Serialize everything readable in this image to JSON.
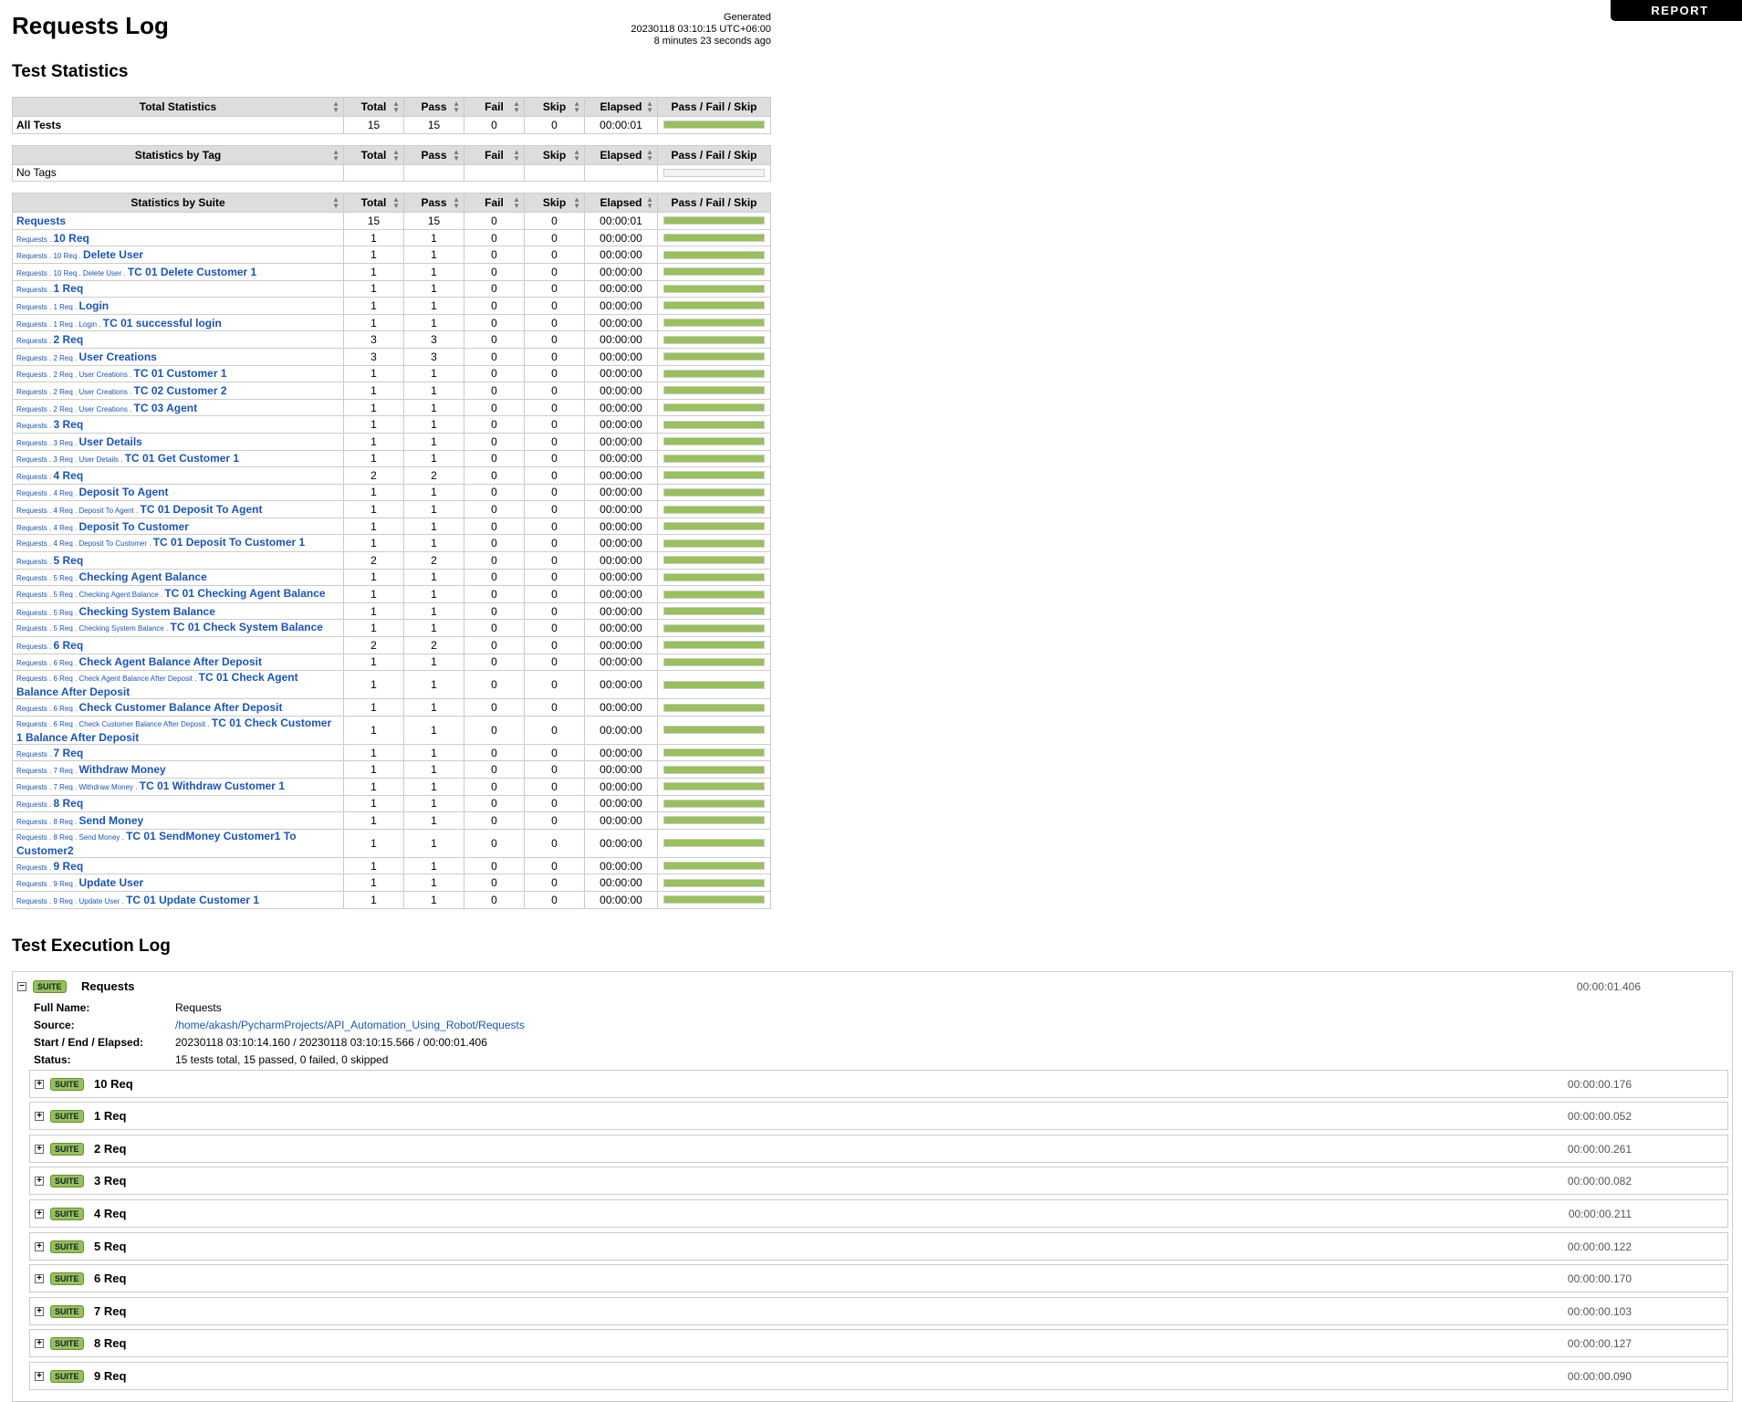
{
  "header": {
    "title": "Requests Log",
    "generated_label": "Generated",
    "generated_time": "20230118 03:10:15 UTC+06:00",
    "generated_ago": "8 minutes 23 seconds ago",
    "report_button": "REPORT"
  },
  "sections": {
    "test_statistics": "Test Statistics",
    "execution_log": "Test Execution Log"
  },
  "columns": [
    "Total",
    "Pass",
    "Fail",
    "Skip",
    "Elapsed",
    "Pass / Fail / Skip"
  ],
  "total_stats": {
    "header": "Total Statistics",
    "rows": [
      {
        "name": "All Tests",
        "total": "15",
        "pass": "15",
        "fail": "0",
        "skip": "0",
        "elapsed": "00:00:01",
        "pass_fraction": 1
      }
    ]
  },
  "tag_stats": {
    "header": "Statistics by Tag",
    "rows": [
      {
        "name": "No Tags",
        "total": "",
        "pass": "",
        "fail": "",
        "skip": "",
        "elapsed": "",
        "pass_fraction": 0
      }
    ]
  },
  "suite_stats": {
    "header": "Statistics by Suite",
    "rows": [
      {
        "parent": "",
        "name": "Requests",
        "total": "15",
        "pass": "15",
        "fail": "0",
        "skip": "0",
        "elapsed": "00:00:01",
        "pass_fraction": 1
      },
      {
        "parent": "Requests . ",
        "name": "10 Req",
        "total": "1",
        "pass": "1",
        "fail": "0",
        "skip": "0",
        "elapsed": "00:00:00",
        "pass_fraction": 1
      },
      {
        "parent": "Requests . 10 Req . ",
        "name": "Delete User",
        "total": "1",
        "pass": "1",
        "fail": "0",
        "skip": "0",
        "elapsed": "00:00:00",
        "pass_fraction": 1
      },
      {
        "parent": "Requests . 10 Req . Delete User . ",
        "name": "TC 01 Delete Customer 1",
        "total": "1",
        "pass": "1",
        "fail": "0",
        "skip": "0",
        "elapsed": "00:00:00",
        "pass_fraction": 1
      },
      {
        "parent": "Requests . ",
        "name": "1 Req",
        "total": "1",
        "pass": "1",
        "fail": "0",
        "skip": "0",
        "elapsed": "00:00:00",
        "pass_fraction": 1
      },
      {
        "parent": "Requests . 1 Req . ",
        "name": "Login",
        "total": "1",
        "pass": "1",
        "fail": "0",
        "skip": "0",
        "elapsed": "00:00:00",
        "pass_fraction": 1
      },
      {
        "parent": "Requests . 1 Req . Login . ",
        "name": "TC 01 successful login",
        "total": "1",
        "pass": "1",
        "fail": "0",
        "skip": "0",
        "elapsed": "00:00:00",
        "pass_fraction": 1
      },
      {
        "parent": "Requests . ",
        "name": "2 Req",
        "total": "3",
        "pass": "3",
        "fail": "0",
        "skip": "0",
        "elapsed": "00:00:00",
        "pass_fraction": 1
      },
      {
        "parent": "Requests . 2 Req . ",
        "name": "User Creations",
        "total": "3",
        "pass": "3",
        "fail": "0",
        "skip": "0",
        "elapsed": "00:00:00",
        "pass_fraction": 1
      },
      {
        "parent": "Requests . 2 Req . User Creations . ",
        "name": "TC 01 Customer 1",
        "total": "1",
        "pass": "1",
        "fail": "0",
        "skip": "0",
        "elapsed": "00:00:00",
        "pass_fraction": 1
      },
      {
        "parent": "Requests . 2 Req . User Creations . ",
        "name": "TC 02 Customer 2",
        "total": "1",
        "pass": "1",
        "fail": "0",
        "skip": "0",
        "elapsed": "00:00:00",
        "pass_fraction": 1
      },
      {
        "parent": "Requests . 2 Req . User Creations . ",
        "name": "TC 03 Agent",
        "total": "1",
        "pass": "1",
        "fail": "0",
        "skip": "0",
        "elapsed": "00:00:00",
        "pass_fraction": 1
      },
      {
        "parent": "Requests . ",
        "name": "3 Req",
        "total": "1",
        "pass": "1",
        "fail": "0",
        "skip": "0",
        "elapsed": "00:00:00",
        "pass_fraction": 1
      },
      {
        "parent": "Requests . 3 Req . ",
        "name": "User Details",
        "total": "1",
        "pass": "1",
        "fail": "0",
        "skip": "0",
        "elapsed": "00:00:00",
        "pass_fraction": 1
      },
      {
        "parent": "Requests . 3 Req . User Details . ",
        "name": "TC 01 Get Customer 1",
        "total": "1",
        "pass": "1",
        "fail": "0",
        "skip": "0",
        "elapsed": "00:00:00",
        "pass_fraction": 1
      },
      {
        "parent": "Requests . ",
        "name": "4 Req",
        "total": "2",
        "pass": "2",
        "fail": "0",
        "skip": "0",
        "elapsed": "00:00:00",
        "pass_fraction": 1
      },
      {
        "parent": "Requests . 4 Req . ",
        "name": "Deposit To Agent",
        "total": "1",
        "pass": "1",
        "fail": "0",
        "skip": "0",
        "elapsed": "00:00:00",
        "pass_fraction": 1
      },
      {
        "parent": "Requests . 4 Req . Deposit To Agent . ",
        "name": "TC 01 Deposit To Agent",
        "total": "1",
        "pass": "1",
        "fail": "0",
        "skip": "0",
        "elapsed": "00:00:00",
        "pass_fraction": 1
      },
      {
        "parent": "Requests . 4 Req . ",
        "name": "Deposit To Customer",
        "total": "1",
        "pass": "1",
        "fail": "0",
        "skip": "0",
        "elapsed": "00:00:00",
        "pass_fraction": 1
      },
      {
        "parent": "Requests . 4 Req . Deposit To Customer . ",
        "name": "TC 01 Deposit To Customer 1",
        "total": "1",
        "pass": "1",
        "fail": "0",
        "skip": "0",
        "elapsed": "00:00:00",
        "pass_fraction": 1
      },
      {
        "parent": "Requests . ",
        "name": "5 Req",
        "total": "2",
        "pass": "2",
        "fail": "0",
        "skip": "0",
        "elapsed": "00:00:00",
        "pass_fraction": 1
      },
      {
        "parent": "Requests . 5 Req . ",
        "name": "Checking Agent Balance",
        "total": "1",
        "pass": "1",
        "fail": "0",
        "skip": "0",
        "elapsed": "00:00:00",
        "pass_fraction": 1
      },
      {
        "parent": "Requests . 5 Req . Checking Agent Balance . ",
        "name": "TC 01 Checking Agent Balance",
        "total": "1",
        "pass": "1",
        "fail": "0",
        "skip": "0",
        "elapsed": "00:00:00",
        "pass_fraction": 1
      },
      {
        "parent": "Requests . 5 Req . ",
        "name": "Checking System Balance",
        "total": "1",
        "pass": "1",
        "fail": "0",
        "skip": "0",
        "elapsed": "00:00:00",
        "pass_fraction": 1
      },
      {
        "parent": "Requests . 5 Req . Checking System Balance . ",
        "name": "TC 01 Check System Balance",
        "total": "1",
        "pass": "1",
        "fail": "0",
        "skip": "0",
        "elapsed": "00:00:00",
        "pass_fraction": 1
      },
      {
        "parent": "Requests . ",
        "name": "6 Req",
        "total": "2",
        "pass": "2",
        "fail": "0",
        "skip": "0",
        "elapsed": "00:00:00",
        "pass_fraction": 1
      },
      {
        "parent": "Requests . 6 Req . ",
        "name": "Check Agent Balance After Deposit",
        "total": "1",
        "pass": "1",
        "fail": "0",
        "skip": "0",
        "elapsed": "00:00:00",
        "pass_fraction": 1
      },
      {
        "parent": "Requests . 6 Req . Check Agent Balance After Deposit . ",
        "name": "TC 01 Check Agent Balance After Deposit",
        "total": "1",
        "pass": "1",
        "fail": "0",
        "skip": "0",
        "elapsed": "00:00:00",
        "pass_fraction": 1
      },
      {
        "parent": "Requests . 6 Req . ",
        "name": "Check Customer Balance After Deposit",
        "total": "1",
        "pass": "1",
        "fail": "0",
        "skip": "0",
        "elapsed": "00:00:00",
        "pass_fraction": 1
      },
      {
        "parent": "Requests . 6 Req . Check Customer Balance After Deposit . ",
        "name": "TC 01 Check Customer 1 Balance After Deposit",
        "total": "1",
        "pass": "1",
        "fail": "0",
        "skip": "0",
        "elapsed": "00:00:00",
        "pass_fraction": 1
      },
      {
        "parent": "Requests . ",
        "name": "7 Req",
        "total": "1",
        "pass": "1",
        "fail": "0",
        "skip": "0",
        "elapsed": "00:00:00",
        "pass_fraction": 1
      },
      {
        "parent": "Requests . 7 Req . ",
        "name": "Withdraw Money",
        "total": "1",
        "pass": "1",
        "fail": "0",
        "skip": "0",
        "elapsed": "00:00:00",
        "pass_fraction": 1
      },
      {
        "parent": "Requests . 7 Req . Withdraw Money . ",
        "name": "TC 01 Withdraw Customer 1",
        "total": "1",
        "pass": "1",
        "fail": "0",
        "skip": "0",
        "elapsed": "00:00:00",
        "pass_fraction": 1
      },
      {
        "parent": "Requests . ",
        "name": "8 Req",
        "total": "1",
        "pass": "1",
        "fail": "0",
        "skip": "0",
        "elapsed": "00:00:00",
        "pass_fraction": 1
      },
      {
        "parent": "Requests . 8 Req . ",
        "name": "Send Money",
        "total": "1",
        "pass": "1",
        "fail": "0",
        "skip": "0",
        "elapsed": "00:00:00",
        "pass_fraction": 1
      },
      {
        "parent": "Requests . 8 Req . Send Money . ",
        "name": "TC 01 SendMoney Customer1 To Customer2",
        "total": "1",
        "pass": "1",
        "fail": "0",
        "skip": "0",
        "elapsed": "00:00:00",
        "pass_fraction": 1
      },
      {
        "parent": "Requests . ",
        "name": "9 Req",
        "total": "1",
        "pass": "1",
        "fail": "0",
        "skip": "0",
        "elapsed": "00:00:00",
        "pass_fraction": 1
      },
      {
        "parent": "Requests . 9 Req . ",
        "name": "Update User",
        "total": "1",
        "pass": "1",
        "fail": "0",
        "skip": "0",
        "elapsed": "00:00:00",
        "pass_fraction": 1
      },
      {
        "parent": "Requests . 9 Req . Update User . ",
        "name": "TC 01 Update Customer 1",
        "total": "1",
        "pass": "1",
        "fail": "0",
        "skip": "0",
        "elapsed": "00:00:00",
        "pass_fraction": 1
      }
    ]
  },
  "log": {
    "root": {
      "label": "SUITE",
      "name": "Requests",
      "elapsed": "00:00:01.406",
      "toggle": "−",
      "meta": [
        {
          "key": "Full Name:",
          "value": "Requests"
        },
        {
          "key": "Source:",
          "value": "/home/akash/PycharmProjects/API_Automation_Using_Robot/Requests"
        },
        {
          "key": "Start / End / Elapsed:",
          "value": "20230118 03:10:14.160 / 20230118 03:10:15.566 / 00:00:01.406"
        },
        {
          "key": "Status:",
          "value": "15 tests total, 15 passed, 0 failed, 0 skipped"
        }
      ]
    },
    "children": [
      {
        "label": "SUITE",
        "name": "10 Req",
        "elapsed": "00:00:00.176",
        "toggle": "+"
      },
      {
        "label": "SUITE",
        "name": "1 Req",
        "elapsed": "00:00:00.052",
        "toggle": "+"
      },
      {
        "label": "SUITE",
        "name": "2 Req",
        "elapsed": "00:00:00.261",
        "toggle": "+"
      },
      {
        "label": "SUITE",
        "name": "3 Req",
        "elapsed": "00:00:00.082",
        "toggle": "+"
      },
      {
        "label": "SUITE",
        "name": "4 Req",
        "elapsed": "00:00:00.211",
        "toggle": "+"
      },
      {
        "label": "SUITE",
        "name": "5 Req",
        "elapsed": "00:00:00.122",
        "toggle": "+"
      },
      {
        "label": "SUITE",
        "name": "6 Req",
        "elapsed": "00:00:00.170",
        "toggle": "+"
      },
      {
        "label": "SUITE",
        "name": "7 Req",
        "elapsed": "00:00:00.103",
        "toggle": "+"
      },
      {
        "label": "SUITE",
        "name": "8 Req",
        "elapsed": "00:00:00.127",
        "toggle": "+"
      },
      {
        "label": "SUITE",
        "name": "9 Req",
        "elapsed": "00:00:00.090",
        "toggle": "+"
      }
    ]
  },
  "colors": {
    "pass": "#99c05a",
    "link": "#1a55b5",
    "header_bg": "#dddddd",
    "suite_label": "#96c05a"
  },
  "icons": {
    "sort": "sort-arrows-icon",
    "expand": "plus-icon",
    "collapse": "minus-icon"
  }
}
